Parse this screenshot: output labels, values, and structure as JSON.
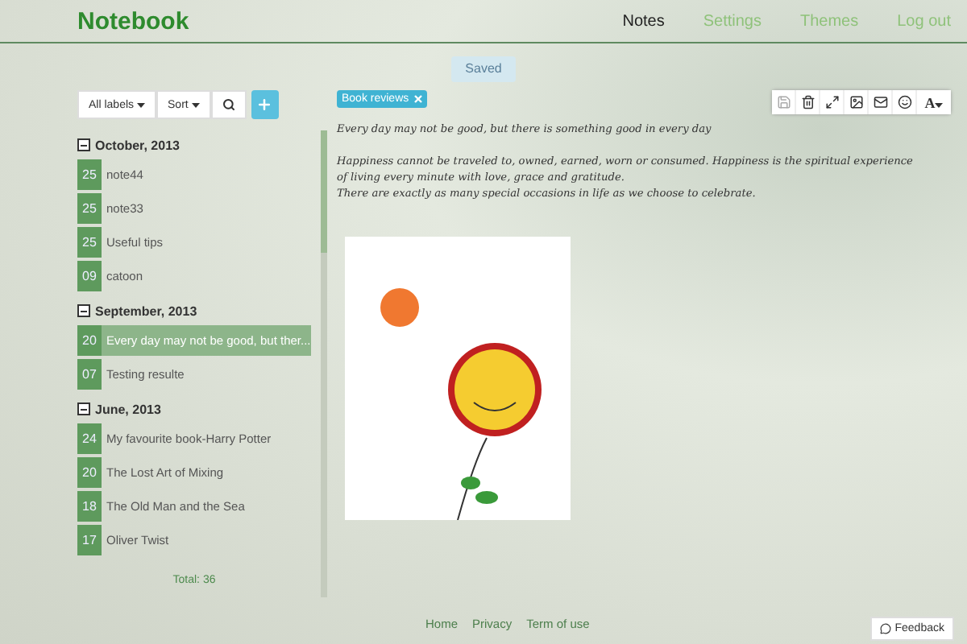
{
  "brand": "Notebook",
  "nav": [
    {
      "label": "Notes",
      "selected": true
    },
    {
      "label": "Settings",
      "selected": false
    },
    {
      "label": "Themes",
      "selected": false
    },
    {
      "label": "Log out",
      "selected": false
    }
  ],
  "status": "Saved",
  "list_toolbar": {
    "labels_button": "All labels",
    "sort_button": "Sort"
  },
  "groups": [
    {
      "title": "October, 2013",
      "expanded": true,
      "notes": [
        {
          "day": "25",
          "title": "note44",
          "selected": false
        },
        {
          "day": "25",
          "title": "note33",
          "selected": false
        },
        {
          "day": "25",
          "title": "Useful tips",
          "selected": false
        },
        {
          "day": "09",
          "title": "catoon",
          "selected": false
        }
      ]
    },
    {
      "title": "September, 2013",
      "expanded": true,
      "notes": [
        {
          "day": "20",
          "title": "Every day may not be good, but ther...",
          "selected": true
        },
        {
          "day": "07",
          "title": "Testing resulte",
          "selected": false
        }
      ]
    },
    {
      "title": "June, 2013",
      "expanded": true,
      "notes": [
        {
          "day": "24",
          "title": "My favourite book-Harry Potter",
          "selected": false
        },
        {
          "day": "20",
          "title": "The Lost Art of Mixing",
          "selected": false
        },
        {
          "day": "18",
          "title": "The Old Man and the Sea",
          "selected": false
        },
        {
          "day": "17",
          "title": "Oliver Twist",
          "selected": false
        }
      ]
    }
  ],
  "total": "Total: 36",
  "tags": [
    "Book reviews"
  ],
  "font_button": "A",
  "note_paragraphs": [
    [
      "Every day may not be good, but there is something good in every day"
    ],
    [
      "Happiness cannot be traveled to, owned, earned, worn or consumed. Happiness is the spiritual experience",
      "of living every minute with love, grace and gratitude.",
      "There are exactly as many special occasions in life as we choose to celebrate."
    ]
  ],
  "footer_links": [
    "Home",
    "Privacy",
    "Term of use"
  ],
  "feedback": "Feedback"
}
